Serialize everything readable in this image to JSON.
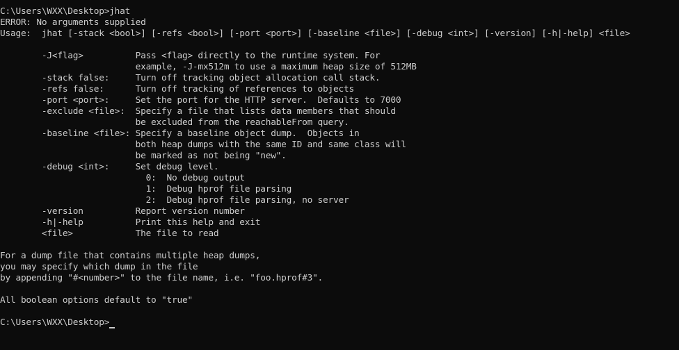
{
  "terminal": {
    "lines": [
      "C:\\Users\\WXX\\Desktop>jhat",
      "ERROR: No arguments supplied",
      "Usage:  jhat [-stack <bool>] [-refs <bool>] [-port <port>] [-baseline <file>] [-debug <int>] [-version] [-h|-help] <file>",
      "",
      "        -J<flag>          Pass <flag> directly to the runtime system. For",
      "                          example, -J-mx512m to use a maximum heap size of 512MB",
      "        -stack false:     Turn off tracking object allocation call stack.",
      "        -refs false:      Turn off tracking of references to objects",
      "        -port <port>:     Set the port for the HTTP server.  Defaults to 7000",
      "        -exclude <file>:  Specify a file that lists data members that should",
      "                          be excluded from the reachableFrom query.",
      "        -baseline <file>: Specify a baseline object dump.  Objects in",
      "                          both heap dumps with the same ID and same class will",
      "                          be marked as not being \"new\".",
      "        -debug <int>:     Set debug level.",
      "                            0:  No debug output",
      "                            1:  Debug hprof file parsing",
      "                            2:  Debug hprof file parsing, no server",
      "        -version          Report version number",
      "        -h|-help          Print this help and exit",
      "        <file>            The file to read",
      "",
      "For a dump file that contains multiple heap dumps,",
      "you may specify which dump in the file",
      "by appending \"#<number>\" to the file name, i.e. \"foo.hprof#3\".",
      "",
      "All boolean options default to \"true\"",
      "",
      "C:\\Users\\WXX\\Desktop>"
    ]
  }
}
